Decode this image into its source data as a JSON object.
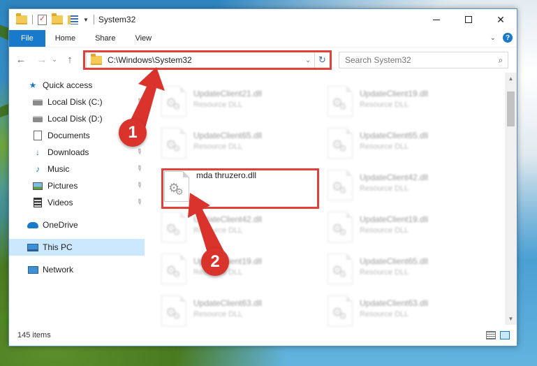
{
  "window": {
    "title": "System32",
    "controls": {
      "minimize": "minimize",
      "maximize": "maximize",
      "close": "✕"
    }
  },
  "ribbon": {
    "tabs": [
      "File",
      "Home",
      "Share",
      "View"
    ],
    "help": "?"
  },
  "address_bar": {
    "path": "C:\\Windows\\System32"
  },
  "search": {
    "placeholder": "Search System32"
  },
  "sidebar": {
    "items": [
      {
        "label": "Quick access",
        "icon": "star-icon"
      },
      {
        "label": "Local Disk (C:)",
        "icon": "drive-icon"
      },
      {
        "label": "Local Disk (D:)",
        "icon": "drive-icon"
      },
      {
        "label": "Documents",
        "icon": "documents-icon"
      },
      {
        "label": "Downloads",
        "icon": "download-icon"
      },
      {
        "label": "Music",
        "icon": "music-icon"
      },
      {
        "label": "Pictures",
        "icon": "pictures-icon"
      },
      {
        "label": "Videos",
        "icon": "videos-icon"
      },
      {
        "label": "OneDrive",
        "icon": "cloud-icon"
      },
      {
        "label": "This PC",
        "icon": "computer-icon"
      },
      {
        "label": "Network",
        "icon": "network-icon"
      }
    ]
  },
  "files": {
    "left_column": [
      {
        "name": "UpdateClient21.dll",
        "type": "Resource DLL"
      },
      {
        "name": "UpdateClient65.dll",
        "type": "Resource DLL"
      },
      {
        "name": "mda thruzero.dll",
        "type": ""
      },
      {
        "name": "UpdateClient42.dll",
        "type": "Resource DLL"
      },
      {
        "name": "UpdateClient19.dll",
        "type": "Resource DLL"
      },
      {
        "name": "UpdateClient63.dll",
        "type": "Resource DLL"
      }
    ],
    "right_column": [
      {
        "name": "UpdateClient19.dll",
        "type": "Resource DLL"
      },
      {
        "name": "UpdateClient65.dll",
        "type": "Resource DLL"
      },
      {
        "name": "UpdateClient42.dll",
        "type": "Resource DLL"
      },
      {
        "name": "UpdateClient19.dll",
        "type": "Resource DLL"
      },
      {
        "name": "UpdateClient65.dll",
        "type": "Resource DLL"
      },
      {
        "name": "UpdateClient63.dll",
        "type": "Resource DLL"
      }
    ]
  },
  "status": {
    "item_count": "145 items"
  },
  "annotations": {
    "step1": "1",
    "step2": "2",
    "color": "#d9332b"
  }
}
